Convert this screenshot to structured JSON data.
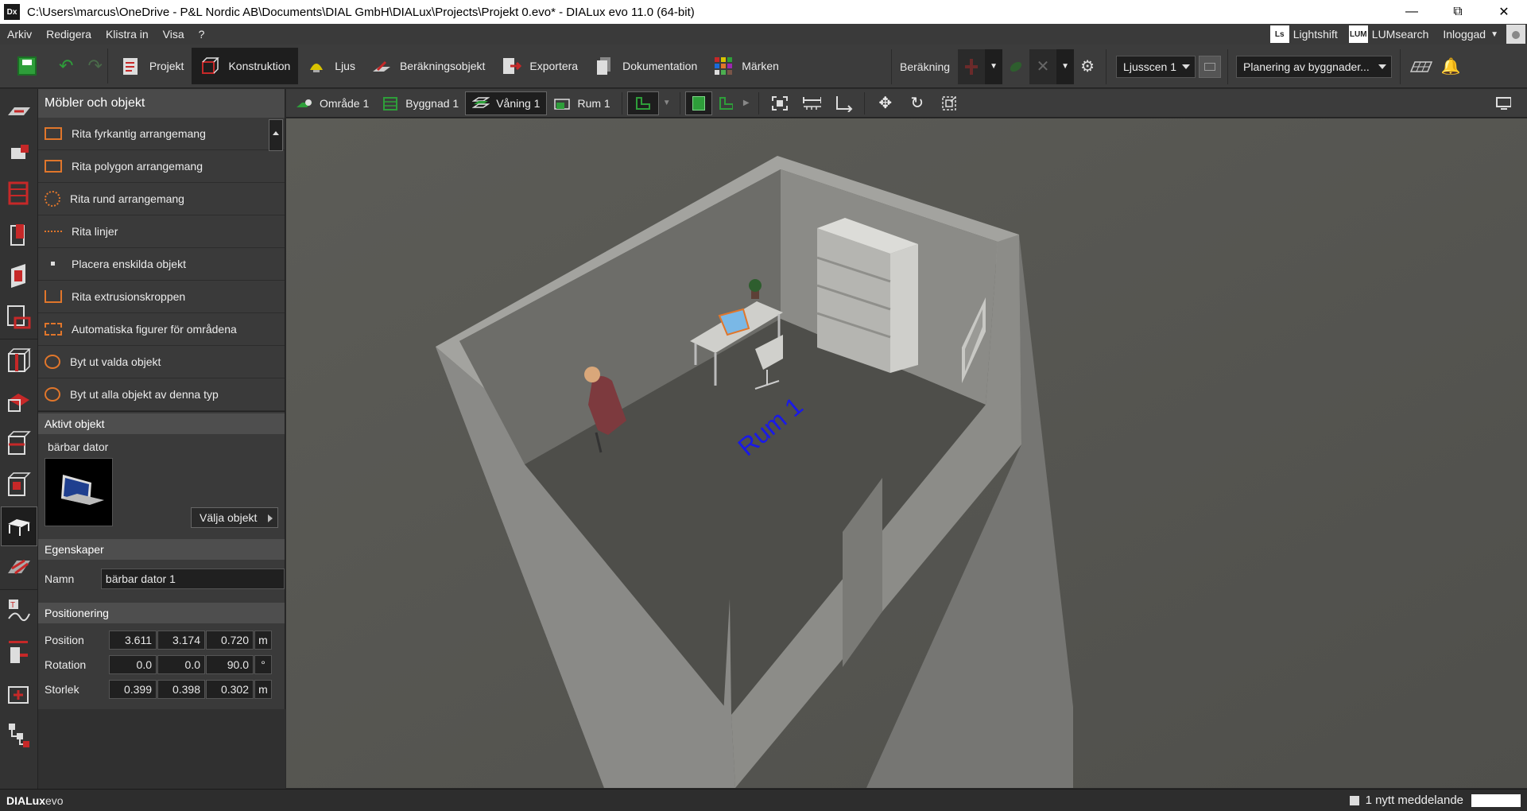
{
  "window": {
    "title": "C:\\Users\\marcus\\OneDrive - P&L Nordic AB\\Documents\\DIAL GmbH\\DIALux\\Projects\\Projekt 0.evo* - DIALux evo 11.0  (64-bit)",
    "app_icon": "Dx"
  },
  "menu": {
    "items": [
      "Arkiv",
      "Redigera",
      "Klistra in",
      "Visa",
      "?"
    ],
    "lightshift": "Lightshift",
    "lightshift_badge": "Ls",
    "lumsearch": "LUMsearch",
    "lumsearch_badge": "LUM",
    "login": "Inloggad"
  },
  "toolbar": {
    "tabs": [
      {
        "label": "Projekt",
        "icon": "clipboard-icon"
      },
      {
        "label": "Konstruktion",
        "icon": "cube-outline-icon",
        "active": true
      },
      {
        "label": "Ljus",
        "icon": "lamp-icon"
      },
      {
        "label": "Beräkningsobjekt",
        "icon": "calc-plane-icon"
      },
      {
        "label": "Exportera",
        "icon": "export-icon"
      },
      {
        "label": "Dokumentation",
        "icon": "document-icon"
      },
      {
        "label": "Märken",
        "icon": "palette-icon"
      }
    ],
    "calc_label": "Beräkning",
    "scene_select": "Ljusscen 1",
    "planning_select": "Planering av byggnader..."
  },
  "panel": {
    "title": "Möbler och objekt",
    "items": [
      {
        "label": "Rita fyrkantig arrangemang",
        "icon": "rect-arrangement-icon"
      },
      {
        "label": "Rita polygon arrangemang",
        "icon": "polygon-arrangement-icon"
      },
      {
        "label": "Rita rund arrangemang",
        "icon": "round-arrangement-icon"
      },
      {
        "label": "Rita linjer",
        "icon": "line-arrangement-icon"
      },
      {
        "label": "Placera enskilda objekt",
        "icon": "single-object-icon"
      },
      {
        "label": "Rita extrusionskroppen",
        "icon": "extrusion-icon"
      },
      {
        "label": "Automatiska figurer för områdena",
        "icon": "magic-wand-icon"
      },
      {
        "label": "Byt ut valda objekt",
        "icon": "replace-icon"
      },
      {
        "label": "Byt ut alla objekt av denna typ",
        "icon": "replace-all-icon"
      }
    ],
    "active_object": {
      "heading": "Aktivt objekt",
      "name": "bärbar dator",
      "select_button": "Välja objekt"
    },
    "properties": {
      "heading": "Egenskaper",
      "name_label": "Namn",
      "name_value": "bärbar dator 1"
    },
    "positioning": {
      "heading": "Positionering",
      "rows": [
        {
          "label": "Position",
          "values": [
            "3.611",
            "3.174",
            "0.720"
          ],
          "unit": "m"
        },
        {
          "label": "Rotation",
          "values": [
            "0.0",
            "0.0",
            "90.0"
          ],
          "unit": "°"
        },
        {
          "label": "Storlek",
          "values": [
            "0.399",
            "0.398",
            "0.302"
          ],
          "unit": "m"
        }
      ]
    }
  },
  "viewtools": {
    "breadcrumb": [
      "Område 1",
      "Byggnad 1",
      "Våning 1",
      "Rum 1"
    ],
    "active_crumb": "Våning 1"
  },
  "viewport": {
    "room_label": "Rum 1"
  },
  "status": {
    "brand_bold": "DIALux",
    "brand_rest": "evo",
    "message": "1 nytt meddelande"
  },
  "colors": {
    "accent_orange": "#e0762b",
    "accent_red": "#c62828",
    "accent_green": "#2e9e3a",
    "room_label_blue": "#1a1ae6"
  }
}
